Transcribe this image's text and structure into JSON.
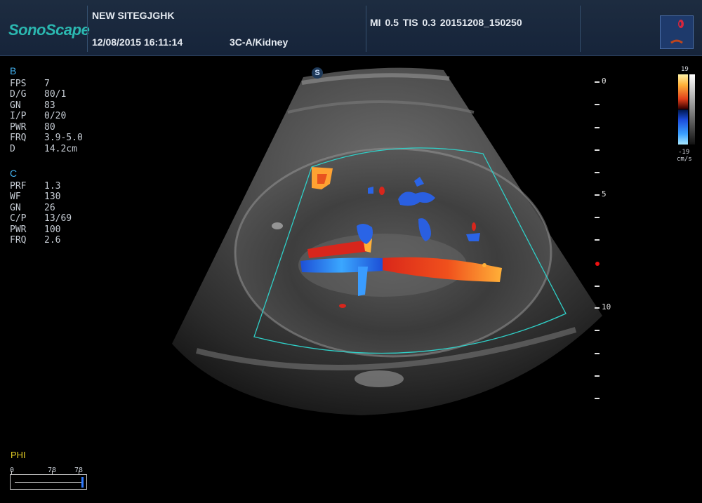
{
  "header": {
    "brand": "SonoScape",
    "site_name": "NEW SITEGJGHK",
    "datetime": "12/08/2015 16:11:14",
    "probe_preset": "3C-A/Kidney",
    "index_info": "MI 0.5  TIS 0.3  20151208_150250",
    "thumbnail_icon": "kidney-icon"
  },
  "b_mode": {
    "heading": "B",
    "params": [
      {
        "key": "FPS",
        "value": "7"
      },
      {
        "key": "D/G",
        "value": "80/1"
      },
      {
        "key": "GN",
        "value": "83"
      },
      {
        "key": "I/P",
        "value": "0/20"
      },
      {
        "key": "PWR",
        "value": "80"
      },
      {
        "key": "FRQ",
        "value": "3.9-5.0"
      },
      {
        "key": "D",
        "value": "14.2cm"
      }
    ]
  },
  "c_mode": {
    "heading": "C",
    "params": [
      {
        "key": "PRF",
        "value": "1.3"
      },
      {
        "key": "WF",
        "value": "130"
      },
      {
        "key": "GN",
        "value": "26"
      },
      {
        "key": "C/P",
        "value": "13/69"
      },
      {
        "key": "PWR",
        "value": "100"
      },
      {
        "key": "FRQ",
        "value": "2.6"
      }
    ]
  },
  "depth_scale": {
    "labels": [
      "0",
      "5",
      "10"
    ]
  },
  "color_bar": {
    "top_value": "19",
    "bottom_value": "-19",
    "unit": "cm/s",
    "positive_color": "#ffb23a",
    "negative_color": "#3aa0ff"
  },
  "phi": {
    "label": "PHI",
    "min_label": "0",
    "mid_label": "78",
    "max_label": "78",
    "level": 1.0
  },
  "colors": {
    "header_bg": "#16243a",
    "accent_teal": "#2bb7b0",
    "roi_box": "#2fd0c8",
    "param_heading": "#43b3f2",
    "phi_label": "#e2cc24"
  },
  "badge": "S"
}
